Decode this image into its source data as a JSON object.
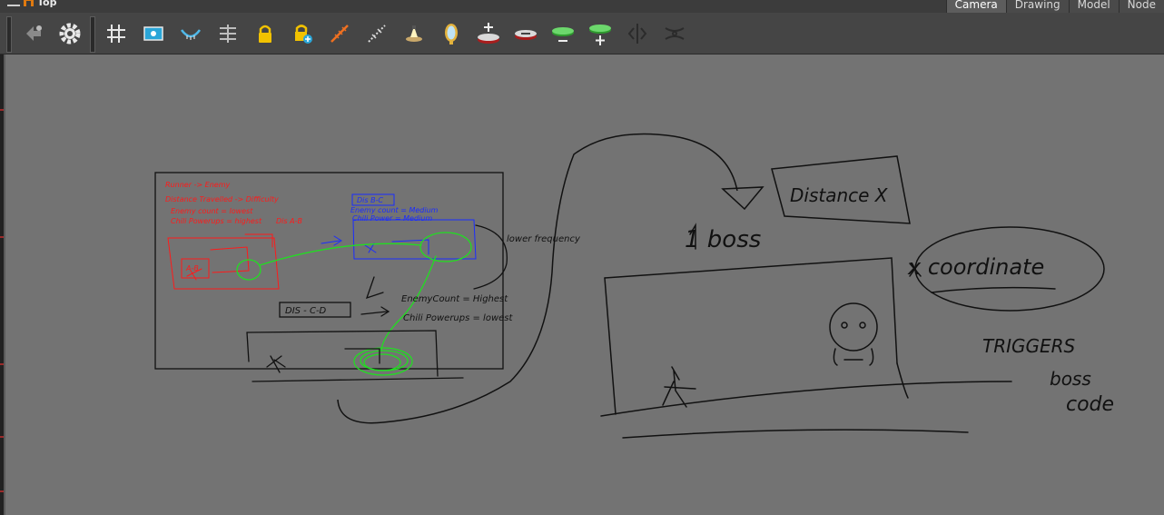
{
  "header": {
    "view_title": "Top",
    "tabs": [
      "Camera",
      "Drawing",
      "Model",
      "Node"
    ]
  },
  "toolbar": {
    "tools": [
      "pointer-icon",
      "gear-icon",
      "grid-icon",
      "frame-icon",
      "smile-icon",
      "align-icon",
      "lock-icon",
      "lock-add-icon",
      "ruler-icon",
      "ruler-dotted-icon",
      "lamp-icon",
      "mirror-icon",
      "add-layer-icon",
      "remove-layer-icon",
      "green-disc-minus-icon",
      "green-disc-plus-icon",
      "flip-icon",
      "morph-icon"
    ]
  },
  "canvas": {
    "left_sketch": {
      "red_notes": [
        "Runner -> Enemy",
        "Distance Travelled -> Difficulty",
        "Enemy count = lowest",
        "Chili Powerups = highest",
        "Dis A-B"
      ],
      "red_box_label": "A-B",
      "blue_notes": [
        "Dis B-C",
        "Enemy count = Medium",
        "Chili Power = Medium"
      ],
      "lower_frequency": "lower frequency",
      "dis_cd": "DIS - C-D",
      "cd_notes": [
        "EnemyCount = Highest",
        "Chili Powerups = lowest"
      ]
    },
    "right_sketch": {
      "distance_box": "Distance X",
      "boss_label": "1 boss",
      "coordinate": "x coordinate",
      "triggers": [
        "TRIGGERS",
        "boss",
        "code"
      ]
    }
  },
  "colors": {
    "canvas_bg": "#737373",
    "toolbar_bg": "#454545",
    "pen_black": "#111111",
    "pen_red": "#ff1a1a",
    "pen_blue": "#1a2cff",
    "pen_green": "#22dd22"
  }
}
